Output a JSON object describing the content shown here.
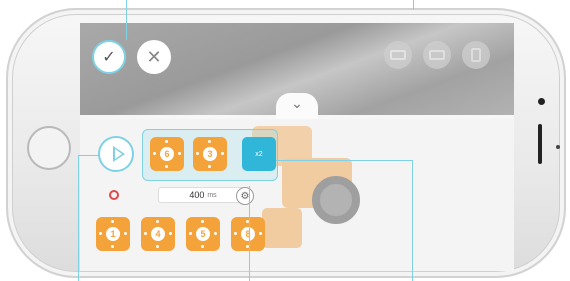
{
  "screen": {
    "accent_color": "#7fd2e4",
    "block_color": "#f4a23a",
    "selected_block_color": "#2fb6d8"
  },
  "top_bar": {
    "confirm_icon": "check-icon",
    "confirm_glyph": "✓",
    "cancel_icon": "close-icon",
    "cancel_glyph": "✕",
    "collapse_icon": "chevron-down-icon",
    "collapse_glyph": "⌄",
    "right_buttons": [
      "controller-icon",
      "keyboard-icon",
      "menu-icon"
    ]
  },
  "player": {
    "play_icon": "play-icon",
    "record_icon": "record-icon"
  },
  "sequence": {
    "blocks": [
      "6",
      "3"
    ],
    "selected_block_label": "x2"
  },
  "timing": {
    "value": "400",
    "unit": "ms",
    "settings_icon": "gear-icon",
    "settings_glyph": "⚙"
  },
  "library": {
    "blocks": [
      "1",
      "4",
      "5",
      "8"
    ]
  }
}
